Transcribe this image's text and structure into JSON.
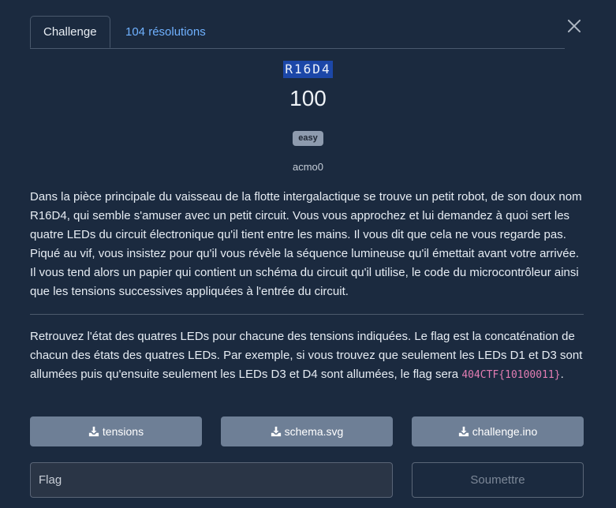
{
  "tabs": {
    "challenge": "Challenge",
    "solves": "104 résolutions"
  },
  "challenge": {
    "name": "R16D4",
    "points": "100",
    "difficulty": "easy",
    "author": "acmo0",
    "description": "Dans la pièce principale du vaisseau de la flotte intergalactique se trouve un petit robot, de son doux nom R16D4, qui semble s'amuser avec un petit circuit. Vous vous approchez et lui demandez à quoi sert les quatre LEDs du circuit électronique qu'il tient entre les mains. Il vous dit que cela ne vous regarde pas. Piqué au vif, vous insistez pour qu'il vous révèle la séquence lumineuse qu'il émettait avant votre arrivée. Il vous tend alors un papier qui contient un schéma du circuit qu'il utilise, le code du microcontrôleur ainsi que les tensions successives appliquées à l'entrée du circuit.",
    "instructions_text": "Retrouvez l'état des quatres LEDs pour chacune des tensions indiquées. Le flag est la concaténation de chacun des états des quatres LEDs. Par exemple, si vous trouvez que seulement les LEDs D1 et D3 sont allumées puis qu'ensuite seulement les LEDs D3 et D4 sont allumées, le flag sera ",
    "instructions_example": "404CTF{10100011}",
    "instructions_end": "."
  },
  "files": [
    {
      "label": "tensions",
      "icon": "download-icon"
    },
    {
      "label": "schema.svg",
      "icon": "download-icon"
    },
    {
      "label": "challenge.ino",
      "icon": "download-icon"
    }
  ],
  "form": {
    "flag_placeholder": "Flag",
    "submit_label": "Soumettre"
  },
  "icons": {
    "close": "close-icon",
    "download": "download-icon"
  },
  "colors": {
    "background": "#1b2a3f",
    "link": "#6fb1ff",
    "button": "#6e7f96",
    "code": "#e37db3"
  }
}
